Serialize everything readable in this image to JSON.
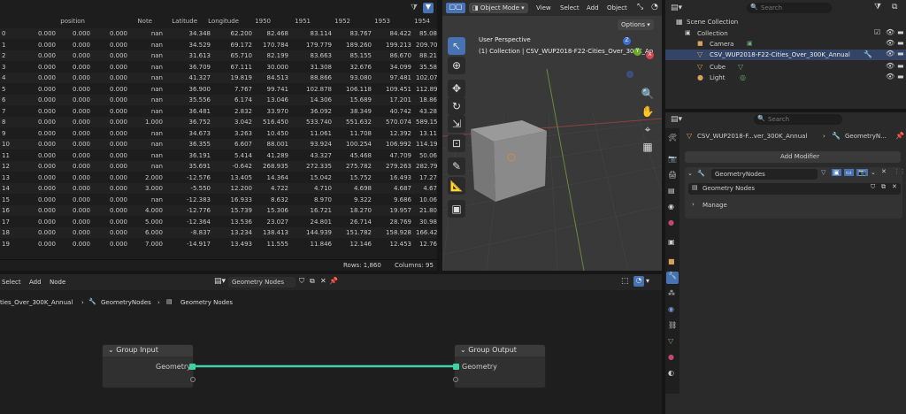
{
  "spreadsheet": {
    "columns": [
      "position",
      "Note",
      "Latitude",
      "Longitude",
      "1950",
      "1951",
      "1952",
      "1953",
      "1954"
    ],
    "rows": [
      [
        "0",
        "0.000",
        "0.000",
        "0.000",
        "nan",
        "34.348",
        "62.200",
        "82.468",
        "83.114",
        "83.767",
        "84.422",
        "85.08"
      ],
      [
        "1",
        "0.000",
        "0.000",
        "0.000",
        "nan",
        "34.529",
        "69.172",
        "170.784",
        "179.779",
        "189.260",
        "199.213",
        "209.70"
      ],
      [
        "2",
        "0.000",
        "0.000",
        "0.000",
        "nan",
        "31.613",
        "65.710",
        "82.199",
        "83.663",
        "85.155",
        "86.670",
        "88.21"
      ],
      [
        "3",
        "0.000",
        "0.000",
        "0.000",
        "nan",
        "36.709",
        "67.111",
        "30.000",
        "31.308",
        "32.676",
        "34.099",
        "35.58"
      ],
      [
        "4",
        "0.000",
        "0.000",
        "0.000",
        "nan",
        "41.327",
        "19.819",
        "84.513",
        "88.866",
        "93.080",
        "97.481",
        "102.07"
      ],
      [
        "5",
        "0.000",
        "0.000",
        "0.000",
        "nan",
        "36.900",
        "7.767",
        "99.741",
        "102.878",
        "106.118",
        "109.451",
        "112.89"
      ],
      [
        "6",
        "0.000",
        "0.000",
        "0.000",
        "nan",
        "35.556",
        "6.174",
        "13.046",
        "14.306",
        "15.689",
        "17.201",
        "18.86"
      ],
      [
        "7",
        "0.000",
        "0.000",
        "0.000",
        "nan",
        "36.481",
        "2.832",
        "33.970",
        "36.092",
        "38.349",
        "40.742",
        "43.28"
      ],
      [
        "8",
        "0.000",
        "0.000",
        "0.000",
        "1.000",
        "36.752",
        "3.042",
        "516.450",
        "533.740",
        "551.632",
        "570.074",
        "589.15"
      ],
      [
        "9",
        "0.000",
        "0.000",
        "0.000",
        "nan",
        "34.673",
        "3.263",
        "10.450",
        "11.061",
        "11.708",
        "12.392",
        "13.11"
      ],
      [
        "10",
        "0.000",
        "0.000",
        "0.000",
        "nan",
        "36.355",
        "6.607",
        "88.001",
        "93.924",
        "100.254",
        "106.992",
        "114.19"
      ],
      [
        "11",
        "0.000",
        "0.000",
        "0.000",
        "nan",
        "36.191",
        "5.414",
        "41.289",
        "43.327",
        "45.468",
        "47.709",
        "50.06"
      ],
      [
        "12",
        "0.000",
        "0.000",
        "0.000",
        "nan",
        "35.691",
        "-0.642",
        "268.935",
        "272.335",
        "275.782",
        "279.263",
        "282.79"
      ],
      [
        "13",
        "0.000",
        "0.000",
        "0.000",
        "2.000",
        "-12.576",
        "13.405",
        "14.364",
        "15.042",
        "15.752",
        "16.493",
        "17.27"
      ],
      [
        "14",
        "0.000",
        "0.000",
        "0.000",
        "3.000",
        "-5.550",
        "12.200",
        "4.722",
        "4.710",
        "4.698",
        "4.687",
        "4.67"
      ],
      [
        "15",
        "0.000",
        "0.000",
        "0.000",
        "nan",
        "-12.383",
        "16.933",
        "8.632",
        "8.970",
        "9.322",
        "9.686",
        "10.06"
      ],
      [
        "16",
        "0.000",
        "0.000",
        "0.000",
        "4.000",
        "-12.776",
        "15.739",
        "15.306",
        "16.721",
        "18.270",
        "19.957",
        "21.80"
      ],
      [
        "17",
        "0.000",
        "0.000",
        "0.000",
        "5.000",
        "-12.364",
        "13.536",
        "23.027",
        "24.801",
        "26.714",
        "28.769",
        "30.98"
      ],
      [
        "18",
        "0.000",
        "0.000",
        "0.000",
        "6.000",
        "-8.837",
        "13.234",
        "138.413",
        "144.939",
        "151.782",
        "158.928",
        "166.42"
      ],
      [
        "19",
        "0.000",
        "0.000",
        "0.000",
        "7.000",
        "-14.917",
        "13.493",
        "11.555",
        "11.846",
        "12.146",
        "12.453",
        "12.76"
      ]
    ],
    "footer_rows": "Rows: 1,860",
    "footer_cols": "Columns: 95"
  },
  "viewport": {
    "mode": "Object Mode",
    "menu": [
      "View",
      "Select",
      "Add",
      "Object"
    ],
    "options": "Options",
    "perspective": "User Perspective",
    "collection": "(1) Collection | CSV_WUP2018-F22-Cities_Over_300K_An"
  },
  "outliner": {
    "search": "Search",
    "scene": "Scene Collection",
    "collection": "Collection",
    "items": [
      "Camera",
      "CSV_WUP2018-F22-Cities_Over_300K_Annual",
      "Cube",
      "Light"
    ]
  },
  "properties": {
    "search": "Search",
    "path_obj": "CSV_WUP2018-F...ver_300K_Annual",
    "path_mod": "GeometryN...",
    "add_modifier": "Add Modifier",
    "modifier_name": "GeometryNodes",
    "group": "Geometry Nodes",
    "manage": "Manage"
  },
  "node_editor": {
    "menu": [
      "Select",
      "Add",
      "Node"
    ],
    "tree": "Geometry Nodes",
    "breadcrumb": [
      "ties_Over_300K_Annual",
      "GeometryNodes",
      "Geometry Nodes"
    ],
    "input_node": "Group Input",
    "input_socket": "Geometry",
    "output_node": "Group Output",
    "output_socket": "Geometry"
  },
  "colors": {
    "accent": "#4772b3",
    "link": "#3fd1a6",
    "bg": "#1d1d1d"
  }
}
